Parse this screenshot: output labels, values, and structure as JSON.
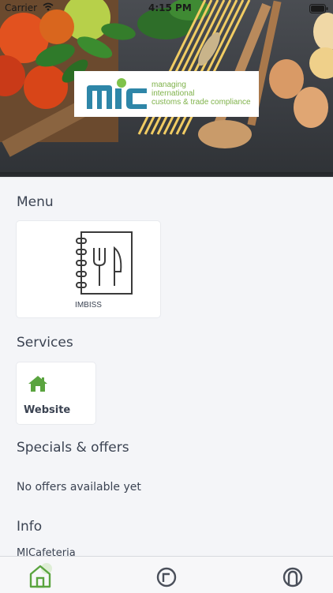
{
  "status_bar": {
    "carrier": "Carrier",
    "time": "4:15 PM"
  },
  "header": {
    "logo_mark": "mic",
    "logo_tagline_lines": [
      "managing",
      "international",
      "customs & trade compliance"
    ]
  },
  "sections": {
    "menu": {
      "title": "Menu",
      "cards": [
        {
          "label": "IMBISS",
          "icon": "menu-book-icon"
        }
      ]
    },
    "services": {
      "title": "Services",
      "cards": [
        {
          "label": "Website",
          "icon": "home-icon"
        }
      ]
    },
    "specials": {
      "title": "Specials & offers",
      "empty_text": "No offers available yet"
    },
    "info": {
      "title": "Info",
      "text": "MICafeteria"
    }
  },
  "tab_bar": {
    "tabs": [
      {
        "icon": "home-tab-icon",
        "active": true
      },
      {
        "icon": "history-tab-icon",
        "active": false
      },
      {
        "icon": "account-tab-icon",
        "active": false
      }
    ]
  },
  "colors": {
    "accent": "#5aa43f",
    "logo_blue": "#2e86a8",
    "text": "#3b4352",
    "background": "#f4f5f8"
  }
}
